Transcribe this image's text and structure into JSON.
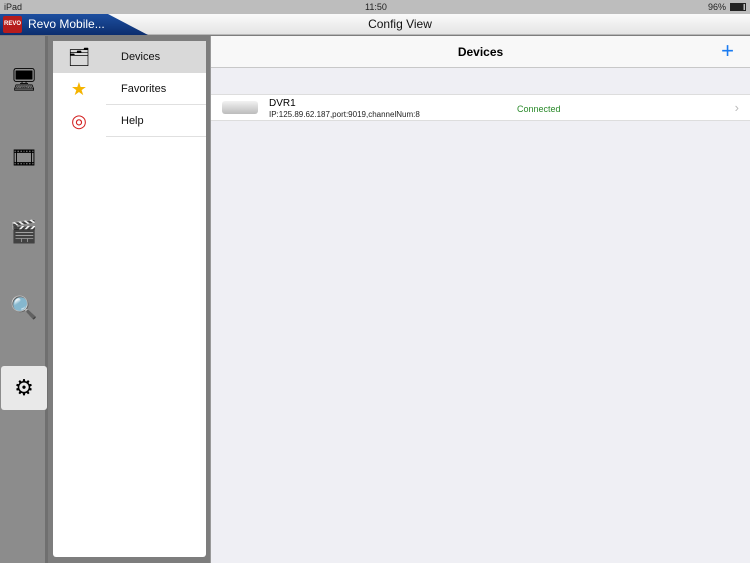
{
  "status": {
    "device": "iPad",
    "time": "11:50",
    "battery": "96%"
  },
  "titlebar": {
    "app_name": "Revo Mobile...",
    "logo": "REVO",
    "title": "Config View"
  },
  "rail": [
    {
      "icon": "live-view-icon"
    },
    {
      "icon": "playback-icon"
    },
    {
      "icon": "video-clip-icon"
    },
    {
      "icon": "image-search-icon"
    },
    {
      "icon": "settings-icon",
      "active": true
    }
  ],
  "menu": {
    "items": [
      {
        "label": "Devices",
        "icon": "devices-icon",
        "selected": true
      },
      {
        "label": "Favorites",
        "icon": "star-icon"
      },
      {
        "label": "Help",
        "icon": "lifebuoy-icon"
      }
    ]
  },
  "main": {
    "title": "Devices",
    "add_label": "+",
    "devices": [
      {
        "name": "DVR1",
        "details": "IP:125.89.62.187,port:9019,channelNum:8",
        "status": "Connected"
      }
    ]
  },
  "colors": {
    "accent": "#1a7bf1",
    "connected": "#2a8a2a"
  }
}
